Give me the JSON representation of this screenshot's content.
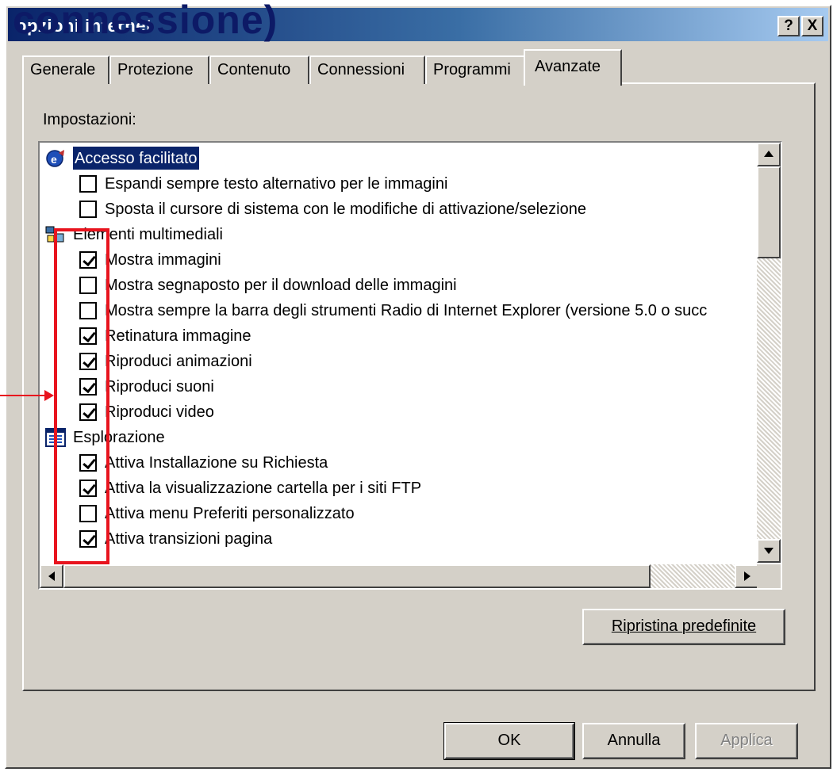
{
  "colors": {
    "title_gradient_start": "#0a246a",
    "title_gradient_end": "#a6caf0",
    "selection_bg": "#0a246a",
    "annotation_red": "#e8141e",
    "window_face": "#d4d0c8"
  },
  "window": {
    "title": "opzioni internet",
    "overlay_title": "connessione)",
    "help_button": "?",
    "close_button": "X"
  },
  "tabs": [
    {
      "label": "Generale",
      "active": false
    },
    {
      "label": "Protezione",
      "active": false
    },
    {
      "label": "Contenuto",
      "active": false
    },
    {
      "label": "Connessioni",
      "active": false
    },
    {
      "label": "Programmi",
      "active": false
    },
    {
      "label": "Avanzate",
      "active": true
    }
  ],
  "settings": {
    "label": "Impostazioni:",
    "items": [
      {
        "type": "category",
        "label": "Accesso facilitato",
        "icon": "accessibility-icon",
        "selected": true
      },
      {
        "type": "option",
        "label": "Espandi sempre testo alternativo per le immagini",
        "checked": false
      },
      {
        "type": "option",
        "label": "Sposta il cursore di sistema con le modifiche di attivazione/selezione",
        "checked": false
      },
      {
        "type": "category",
        "label": "Elementi multimediali",
        "icon": "multimedia-icon",
        "selected": false
      },
      {
        "type": "option",
        "label": "Mostra immagini",
        "checked": true
      },
      {
        "type": "option",
        "label": "Mostra segnaposto per il download delle immagini",
        "checked": false
      },
      {
        "type": "option",
        "label": "Mostra sempre la barra degli strumenti  Radio di Internet Explorer (versione 5.0 o succ",
        "checked": false
      },
      {
        "type": "option",
        "label": "Retinatura immagine",
        "checked": true
      },
      {
        "type": "option",
        "label": "Riproduci animazioni",
        "checked": true
      },
      {
        "type": "option",
        "label": "Riproduci suoni",
        "checked": true
      },
      {
        "type": "option",
        "label": "Riproduci video",
        "checked": true
      },
      {
        "type": "category",
        "label": "Esplorazione",
        "icon": "browsing-icon",
        "selected": false
      },
      {
        "type": "option",
        "label": "Attiva Installazione su Richiesta",
        "checked": true
      },
      {
        "type": "option",
        "label": "Attiva la visualizzazione cartella per i siti FTP",
        "checked": true
      },
      {
        "type": "option",
        "label": "Attiva menu Preferiti personalizzato",
        "checked": false
      },
      {
        "type": "option",
        "label": "Attiva transizioni pagina",
        "checked": true
      }
    ]
  },
  "buttons": {
    "restore_defaults": "Ripristina predefinite",
    "ok": "OK",
    "cancel": "Annulla",
    "apply": "Applica",
    "apply_enabled": false
  }
}
